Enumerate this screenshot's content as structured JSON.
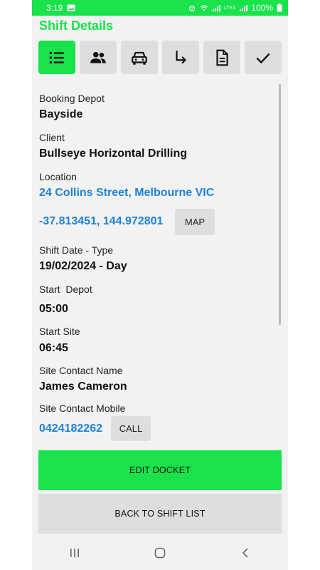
{
  "status_bar": {
    "time": "3:19",
    "battery": "100%",
    "network": "LTE1"
  },
  "header": {
    "title": "Shift Details"
  },
  "tabs": [
    {
      "icon": "list-icon",
      "active": true
    },
    {
      "icon": "people-icon",
      "active": false
    },
    {
      "icon": "car-icon",
      "active": false
    },
    {
      "icon": "arrow-turn-icon",
      "active": false
    },
    {
      "icon": "document-icon",
      "active": false
    },
    {
      "icon": "check-icon",
      "active": false
    }
  ],
  "details": {
    "booking_depot_label": "Booking Depot",
    "booking_depot": "Bayside",
    "client_label": "Client",
    "client": "Bullseye Horizontal Drilling",
    "location_label": "Location",
    "location": "24 Collins Street, Melbourne VIC",
    "coordinates": "-37.813451, 144.972801",
    "map_label": "MAP",
    "shift_date_label": "Shift Date - Type",
    "shift_date": "19/02/2024 - Day",
    "start_depot_label": "Start  Depot",
    "start_depot": "05:00",
    "start_site_label": "Start Site",
    "start_site": "06:45",
    "site_contact_name_label": "Site Contact Name",
    "site_contact_name": "James Cameron",
    "site_contact_mobile_label": "Site Contact Mobile",
    "site_contact_mobile": "0424182262",
    "call_label": "CALL"
  },
  "actions": {
    "edit_docket": "EDIT DOCKET",
    "back_to_shift_list": "BACK TO SHIFT LIST"
  },
  "colors": {
    "accent": "#19e24a",
    "link": "#1f82d8",
    "button_gray": "#dedede",
    "background": "#f2f2f2"
  }
}
